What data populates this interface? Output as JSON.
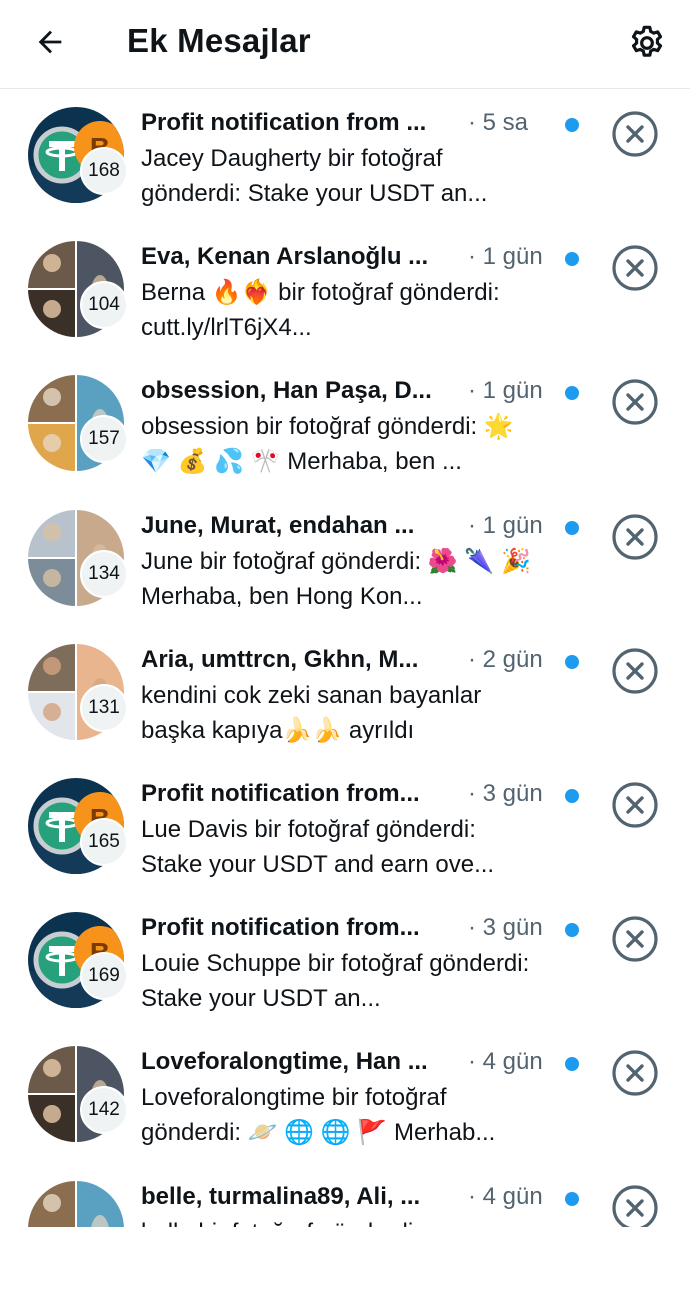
{
  "header": {
    "title": "Ek Mesajlar",
    "back_icon": "arrow-left-icon",
    "settings_icon": "gear-icon"
  },
  "colors": {
    "accent": "#1d9bf0",
    "muted": "#536471",
    "text": "#0f1419",
    "dismiss": "#536471"
  },
  "conversations": [
    {
      "name": "Profit notification from ...",
      "time": "· 5 sa",
      "preview": "Jacey Daugherty bir fotoğraf gönderdi: Stake your USDT an...",
      "count": "168",
      "avatar": "crypto"
    },
    {
      "name": "Eva, Kenan Arslanoğlu ...",
      "time": "· 1 gün",
      "preview": "Berna 🔥❤️‍🔥 bir fotoğraf gönderdi: cutt.ly/lrlT6jX4...",
      "count": "104",
      "avatar": "group"
    },
    {
      "name": "obsession, Han Paşa, D...",
      "time": "· 1 gün",
      "preview": "obsession bir fotoğraf gönderdi: 🌟 💎 💰 💦 🎌 Merhaba, ben ...",
      "count": "157",
      "avatar": "group"
    },
    {
      "name": "June, Murat, endahan ...",
      "time": "· 1 gün",
      "preview": "June bir fotoğraf gönderdi: 🌺 🌂 🎉 Merhaba, ben Hong Kon...",
      "count": "134",
      "avatar": "group"
    },
    {
      "name": "Aria, umttrcn, Gkhn, M...",
      "time": "· 2 gün",
      "preview": "kendini cok zeki sanan bayanlar başka kapıya🍌🍌 ayrıldı",
      "count": "131",
      "avatar": "group"
    },
    {
      "name": "Profit notification from...",
      "time": "· 3 gün",
      "preview": "Lue Davis bir fotoğraf gönderdi: Stake your USDT and earn ove...",
      "count": "165",
      "avatar": "crypto"
    },
    {
      "name": "Profit notification from...",
      "time": "· 3 gün",
      "preview": "Louie Schuppe bir fotoğraf gönderdi: Stake your USDT an...",
      "count": "169",
      "avatar": "crypto"
    },
    {
      "name": "Loveforalongtime, Han ...",
      "time": "· 4 gün",
      "preview": "Loveforalongtime bir fotoğraf gönderdi: 🪐 🌐 🌐 🚩 Merhab...",
      "count": "142",
      "avatar": "group"
    },
    {
      "name": "belle, turmalina89, Ali, ...",
      "time": "· 4 gün",
      "preview": "belle bir fotoğraf gönderdi:",
      "count": "",
      "avatar": "group"
    }
  ]
}
